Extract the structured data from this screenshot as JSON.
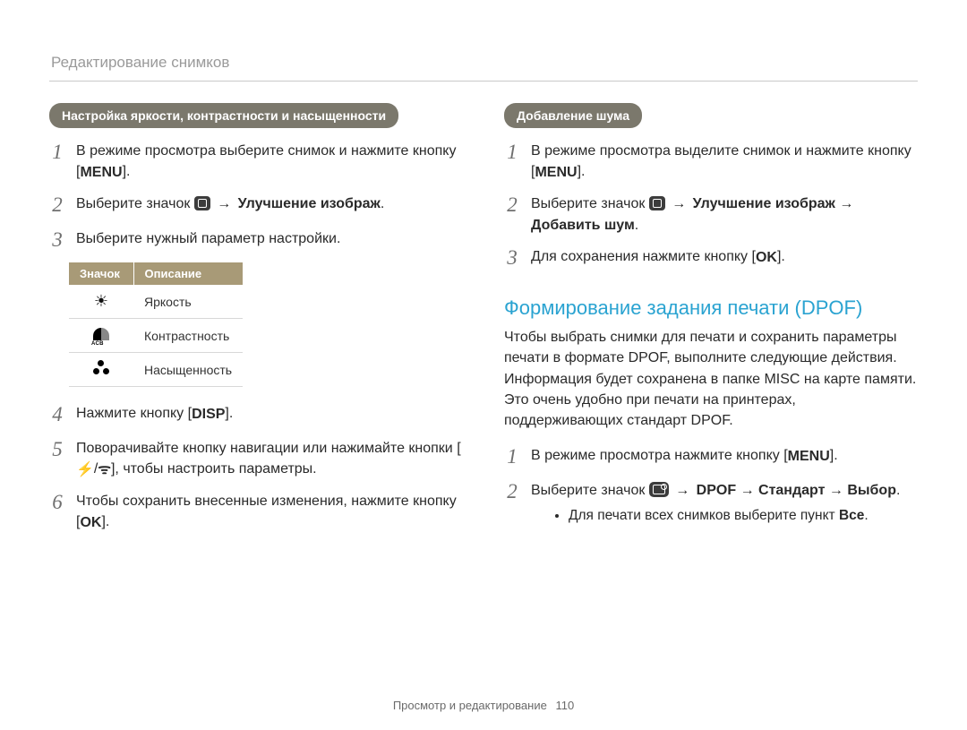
{
  "breadcrumb": "Редактирование снимков",
  "left": {
    "section_title": "Настройка яркости, контрастности и насыщенности",
    "steps": {
      "s1a": "В режиме просмотра выберите снимок и нажмите кнопку [",
      "s1b": "].",
      "menu_label": "MENU",
      "s2a": "Выберите значок ",
      "s2b": " → ",
      "s2c": ".",
      "improve": "Улучшение изображ",
      "s3": "Выберите нужный параметр настройки.",
      "s4a": "Нажмите кнопку [",
      "disp": "DISP",
      "s4b": "].",
      "s5a": "Поворачивайте кнопку навигации или нажимайте кнопки [",
      "s5b": "/",
      "s5c": "], чтобы настроить параметры.",
      "flash": "⚡",
      "wifi": "ᯤ",
      "s6a": "Чтобы сохранить внесенные изменения, нажмите кнопку [",
      "ok": "OK",
      "s6b": "]."
    },
    "table": {
      "h1": "Значок",
      "h2": "Описание",
      "r1": "Яркость",
      "r2": "Контрастность",
      "r3": "Насыщенность"
    }
  },
  "right": {
    "section_title": "Добавление шума",
    "steps": {
      "s1a": "В режиме просмотра выделите снимок и нажмите кнопку [",
      "menu_label": "MENU",
      "s1b": "].",
      "s2a": "Выберите значок ",
      "s2b": " → ",
      "improve": "Улучшение изображ",
      "s2c": " → ",
      "add_noise": "Добавить шум",
      "s2d": ".",
      "s3a": "Для сохранения нажмите кнопку [",
      "ok": "OK",
      "s3b": "]."
    },
    "h2": "Формирование задания печати (DPOF)",
    "para": "Чтобы выбрать снимки для печати и сохранить параметры печати в формате DPOF, выполните следующие действия. Информация будет сохранена в папке MISC на карте памяти. Это очень удобно при печати на принтерах, поддерживающих стандарт DPOF.",
    "steps2": {
      "s1a": "В режиме просмотра нажмите кнопку [",
      "menu_label": "MENU",
      "s1b": "].",
      "s2a": "Выберите значок ",
      "s2b": " → ",
      "dpof": "DPOF",
      "s2c": " → ",
      "standard": "Стандарт",
      "s2d": " → ",
      "vybor": "Выбор",
      "s2e": ".",
      "bullet_a": "Для печати всех снимков выберите пункт ",
      "bullet_b": "Все",
      "bullet_c": "."
    }
  },
  "footer": {
    "section": "Просмотр и редактирование",
    "page": "110"
  }
}
